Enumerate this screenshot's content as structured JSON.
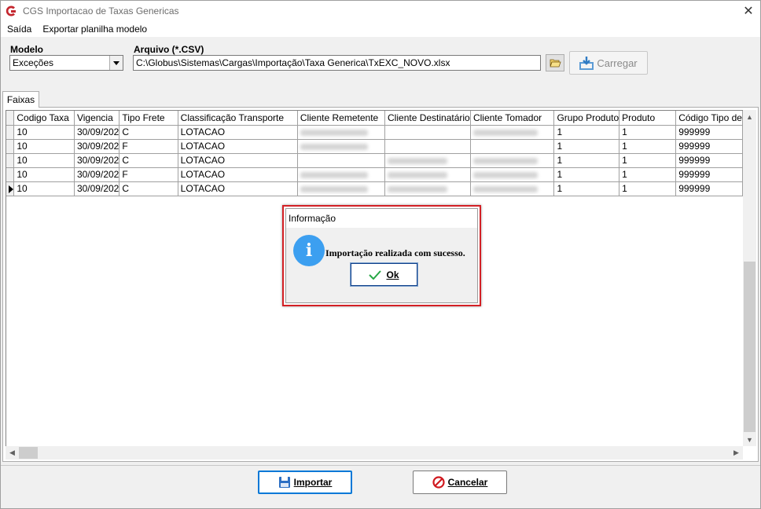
{
  "window": {
    "title": "CGS Importacao de Taxas Genericas",
    "close_symbol": "✕"
  },
  "menu": [
    "Saída",
    "Exportar planilha modelo"
  ],
  "form": {
    "modelo_label": "Modelo",
    "modelo_value": "Exceções",
    "arquivo_label": "Arquivo (*.CSV)",
    "arquivo_value": "C:\\Globus\\Sistemas\\Cargas\\Importação\\Taxa Generica\\TxEXC_NOVO.xlsx",
    "carregar_label": "Carregar"
  },
  "tab": {
    "label": "Faixas"
  },
  "table": {
    "columns": [
      "Codigo Taxa",
      "Vigencia",
      "Tipo Frete",
      "Classificação Transporte",
      "Cliente Remetente",
      "Cliente Destinatário",
      "Cliente Tomador",
      "Grupo Produto",
      "Produto",
      "Código Tipo de"
    ],
    "rows": [
      {
        "codigo": "10",
        "vigencia": "30/09/202",
        "tipo": "C",
        "classif": "LOTACAO",
        "grupo": "1",
        "produto": "1",
        "codtipo": "999999",
        "blur": [
          true,
          false,
          true
        ]
      },
      {
        "codigo": "10",
        "vigencia": "30/09/202",
        "tipo": "F",
        "classif": "LOTACAO",
        "grupo": "1",
        "produto": "1",
        "codtipo": "999999",
        "blur": [
          true,
          false,
          false
        ]
      },
      {
        "codigo": "10",
        "vigencia": "30/09/202",
        "tipo": "C",
        "classif": "LOTACAO",
        "grupo": "1",
        "produto": "1",
        "codtipo": "999999",
        "blur": [
          false,
          true,
          true
        ]
      },
      {
        "codigo": "10",
        "vigencia": "30/09/202",
        "tipo": "F",
        "classif": "LOTACAO",
        "grupo": "1",
        "produto": "1",
        "codtipo": "999999",
        "blur": [
          true,
          true,
          true
        ]
      },
      {
        "codigo": "10",
        "vigencia": "30/09/202",
        "tipo": "C",
        "classif": "LOTACAO",
        "grupo": "1",
        "produto": "1",
        "codtipo": "999999",
        "blur": [
          true,
          true,
          true
        ],
        "current": true
      }
    ]
  },
  "buttons": {
    "importar": "Importar",
    "cancelar": "Cancelar"
  },
  "dialog": {
    "title": "Informação",
    "message": "Importação realizada com sucesso.",
    "ok_label": "Ok",
    "icon": "info-icon"
  },
  "colors": {
    "highlight": "#d32025",
    "info": "#3c9ff0",
    "focus": "#0078d7"
  }
}
